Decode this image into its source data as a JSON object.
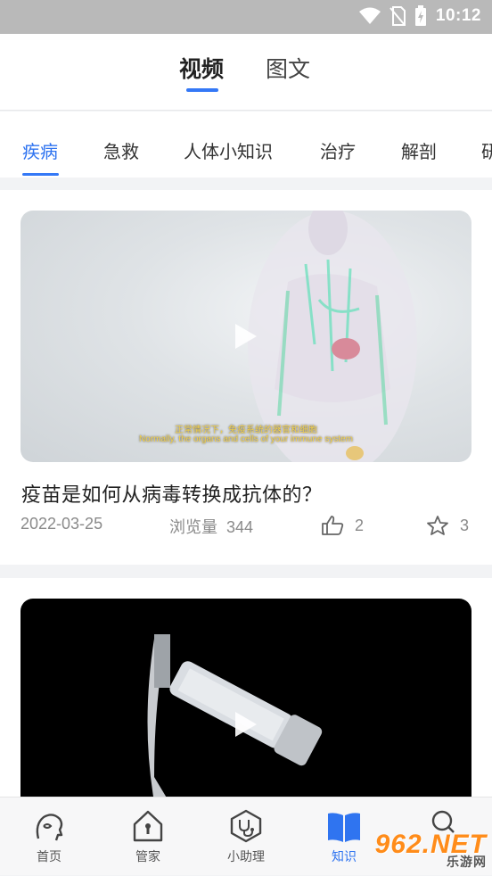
{
  "status_bar": {
    "time": "10:12"
  },
  "top_tabs": [
    {
      "label": "视频",
      "active": true
    },
    {
      "label": "图文",
      "active": false
    }
  ],
  "categories": [
    {
      "label": "疾病",
      "active": true
    },
    {
      "label": "急救"
    },
    {
      "label": "人体小知识"
    },
    {
      "label": "治疗"
    },
    {
      "label": "解剖"
    },
    {
      "label": "研"
    }
  ],
  "cards": [
    {
      "title": "疫苗是如何从病毒转换成抗体的？",
      "date": "2022-03-25",
      "views_label": "浏览量",
      "views": "344",
      "likes": "2",
      "favorites": "3",
      "subtitle_cn": "正常情况下，免疫系统的器官和细胞",
      "subtitle_en": "Normally, the organs and cells of your immune system"
    },
    {
      "title": ""
    }
  ],
  "bottom_nav": [
    {
      "label": "首页",
      "icon": "home-head-icon",
      "active": false
    },
    {
      "label": "管家",
      "icon": "house-keyhole-icon",
      "active": false
    },
    {
      "label": "小助理",
      "icon": "stethoscope-icon",
      "active": false
    },
    {
      "label": "知识",
      "icon": "book-icon",
      "active": true
    },
    {
      "label": "",
      "icon": "search-icon",
      "active": false
    }
  ],
  "watermark": {
    "main": "962.NET",
    "sub": "乐游网"
  },
  "colors": {
    "accent": "#3478f6",
    "text": "#222222",
    "muted": "#8a8a8a"
  }
}
